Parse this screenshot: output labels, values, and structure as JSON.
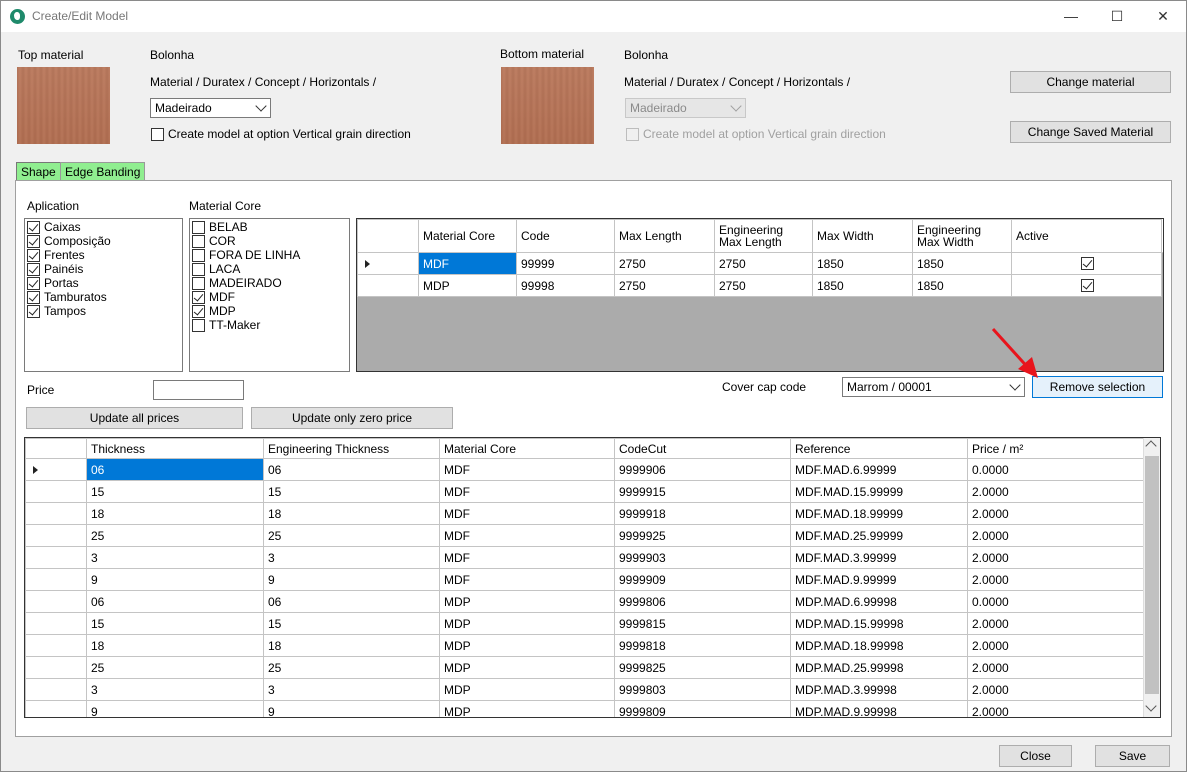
{
  "window": {
    "title": "Create/Edit Model",
    "controls": {
      "minimize": "—",
      "maximize": "☐",
      "close": "✕"
    }
  },
  "top_material": {
    "label": "Top material",
    "name": "Bolonha",
    "path": "Material / Duratex / Concept / Horizontals /",
    "finish": "Madeirado",
    "vertical_grain_label": "Create model at option Vertical grain direction",
    "vertical_grain_checked": false
  },
  "bottom_material": {
    "label": "Bottom material",
    "name": "Bolonha",
    "path": "Material / Duratex / Concept / Horizontals /",
    "finish": "Madeirado",
    "vertical_grain_label": "Create model at option Vertical grain direction",
    "vertical_grain_checked": false
  },
  "buttons": {
    "change_material": "Change material",
    "change_saved_material": "Change Saved Material",
    "update_all_prices": "Update all prices",
    "update_zero_price": "Update only zero price",
    "remove_selection": "Remove selection",
    "close": "Close",
    "save": "Save"
  },
  "tabs": [
    "Shape",
    "Edge Banding"
  ],
  "aplication": {
    "label": "Aplication",
    "items": [
      {
        "label": "Caixas",
        "checked": true
      },
      {
        "label": "Composição",
        "checked": true
      },
      {
        "label": "Frentes",
        "checked": true
      },
      {
        "label": "Painéis",
        "checked": true
      },
      {
        "label": "Portas",
        "checked": true
      },
      {
        "label": "Tamburatos",
        "checked": true
      },
      {
        "label": "Tampos",
        "checked": true
      }
    ]
  },
  "material_core": {
    "label": "Material Core",
    "items": [
      {
        "label": "BELAB",
        "checked": false
      },
      {
        "label": "COR",
        "checked": false
      },
      {
        "label": "FORA DE LINHA",
        "checked": false
      },
      {
        "label": "LACA",
        "checked": false
      },
      {
        "label": "MADEIRADO",
        "checked": false
      },
      {
        "label": "MDF",
        "checked": true
      },
      {
        "label": "MDP",
        "checked": true
      },
      {
        "label": "TT-Maker",
        "checked": false
      }
    ]
  },
  "core_grid": {
    "headers": [
      "Material Core",
      "Code",
      "Max Length",
      "Engineering Max Length",
      "Max Width",
      "Engineering Max Width",
      "Active"
    ],
    "headers_line1": [
      "Material Core",
      "Code",
      "Max Length",
      "Engineering",
      "Max Width",
      "Engineering",
      "Active"
    ],
    "headers_line2": [
      "",
      "",
      "",
      "Max Length",
      "",
      "Max Width",
      ""
    ],
    "rows": [
      {
        "core": "MDF",
        "code": "99999",
        "max_length": "2750",
        "eng_max_length": "2750",
        "max_width": "1850",
        "eng_max_width": "1850",
        "active": true
      },
      {
        "core": "MDP",
        "code": "99998",
        "max_length": "2750",
        "eng_max_length": "2750",
        "max_width": "1850",
        "eng_max_width": "1850",
        "active": true
      }
    ]
  },
  "price": {
    "label": "Price",
    "value": ""
  },
  "cover_cap": {
    "label": "Cover cap code",
    "value": "Marrom / 00001"
  },
  "thickness_grid": {
    "headers": [
      "Thickness",
      "Engineering Thickness",
      "Material Core",
      "CodeCut",
      "Reference",
      "Price / m²"
    ],
    "rows": [
      [
        "06",
        "06",
        "MDF",
        "9999906",
        "MDF.MAD.6.99999",
        "0.0000"
      ],
      [
        "15",
        "15",
        "MDF",
        "9999915",
        "MDF.MAD.15.99999",
        "2.0000"
      ],
      [
        "18",
        "18",
        "MDF",
        "9999918",
        "MDF.MAD.18.99999",
        "2.0000"
      ],
      [
        "25",
        "25",
        "MDF",
        "9999925",
        "MDF.MAD.25.99999",
        "2.0000"
      ],
      [
        "3",
        "3",
        "MDF",
        "9999903",
        "MDF.MAD.3.99999",
        "2.0000"
      ],
      [
        "9",
        "9",
        "MDF",
        "9999909",
        "MDF.MAD.9.99999",
        "2.0000"
      ],
      [
        "06",
        "06",
        "MDP",
        "9999806",
        "MDP.MAD.6.99998",
        "0.0000"
      ],
      [
        "15",
        "15",
        "MDP",
        "9999815",
        "MDP.MAD.15.99998",
        "2.0000"
      ],
      [
        "18",
        "18",
        "MDP",
        "9999818",
        "MDP.MAD.18.99998",
        "2.0000"
      ],
      [
        "25",
        "25",
        "MDP",
        "9999825",
        "MDP.MAD.25.99998",
        "2.0000"
      ],
      [
        "3",
        "3",
        "MDP",
        "9999803",
        "MDP.MAD.3.99998",
        "2.0000"
      ],
      [
        "9",
        "9",
        "MDP",
        "9999809",
        "MDP.MAD.9.99998",
        "2.0000"
      ]
    ]
  },
  "colors": {
    "accent": "#0078d7",
    "tab": "#90ee90",
    "swatch": "#b87355",
    "annotation_arrow": "#e8141c"
  },
  "icons": [
    "app-icon",
    "minimize-icon",
    "maximize-icon",
    "close-icon",
    "dropdown-arrow-icon",
    "row-indicator-icon",
    "annotation-arrow-icon",
    "scroll-up-icon",
    "scroll-down-icon"
  ]
}
